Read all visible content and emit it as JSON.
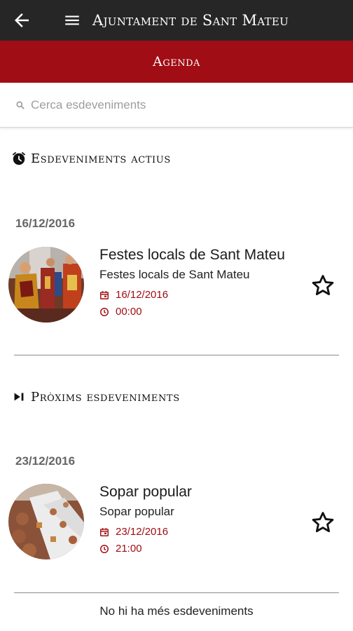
{
  "header": {
    "title": "Ajuntament de Sant Mateu",
    "back_icon": "arrow-left-icon",
    "menu_icon": "hamburger-menu-icon",
    "background": "#262626"
  },
  "section": {
    "title": "Agenda",
    "background": "#a00d14"
  },
  "search": {
    "placeholder": "Cerca esdeveniments",
    "value": ""
  },
  "active": {
    "heading": "Esdeveniments actius",
    "icon": "alarm-clock-icon",
    "date": "16/12/2016",
    "event": {
      "name": "Festes locals de Sant Mateu",
      "subtitle": "Festes locals de Sant Mateu",
      "date": "16/12/2016",
      "time": "00:00",
      "favorite": false
    }
  },
  "upcoming": {
    "heading": "Pròxims esdeveniments",
    "icon": "skip-next-icon",
    "date": "23/12/2016",
    "event": {
      "name": "Sopar popular",
      "subtitle": "Sopar popular",
      "date": "23/12/2016",
      "time": "21:00",
      "favorite": false
    }
  },
  "footer": {
    "text": "No hi ha més esdeveniments"
  },
  "colors": {
    "accent": "#a00d14",
    "muted_text": "#666666"
  }
}
